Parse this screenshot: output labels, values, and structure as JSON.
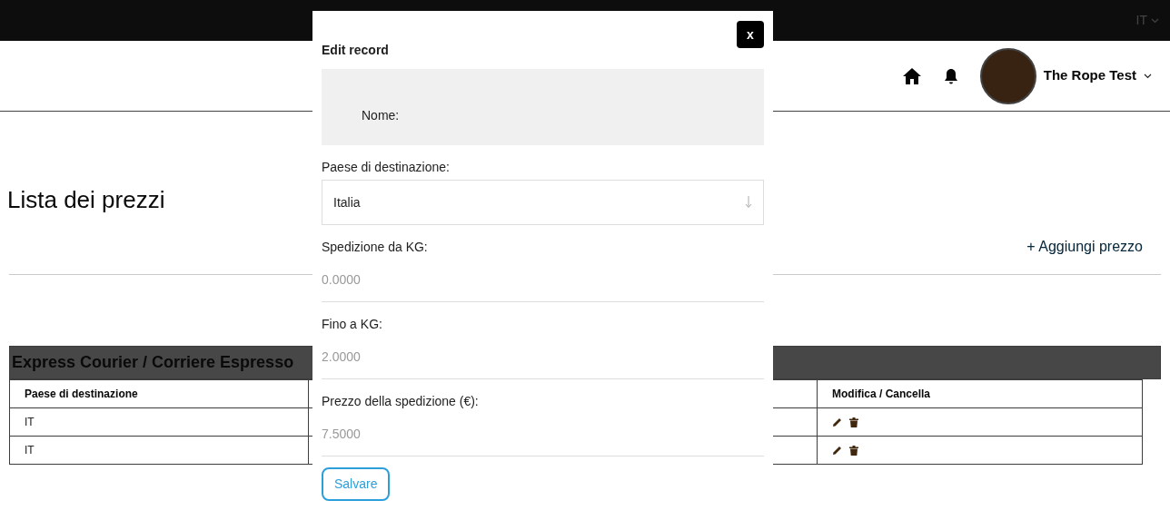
{
  "top_bar": {
    "language": "IT"
  },
  "header": {
    "user_name": "The Rope Test"
  },
  "page": {
    "title": "Lista dei prezzi",
    "add_link": "+ Aggiungi prezzo"
  },
  "section": {
    "title": "Express Courier / Corriere Espresso"
  },
  "table": {
    "columns": [
      "Paese di destinazione",
      "Modifica / Cancella"
    ],
    "rows": [
      {
        "destination": "IT"
      },
      {
        "destination": "IT"
      }
    ]
  },
  "modal": {
    "title": "Edit record",
    "close": "x",
    "name_label": "Nome:",
    "fields": [
      {
        "kind": "select",
        "label": "Paese di destinazione:",
        "value": "Italia"
      },
      {
        "kind": "number",
        "label": "Spedizione da KG:",
        "placeholder": "0.0000"
      },
      {
        "kind": "number",
        "label": "Fino a KG:",
        "placeholder": "2.0000"
      },
      {
        "kind": "number",
        "label": "Prezzo della spedizione (€):",
        "placeholder": "7.5000"
      }
    ],
    "save_button": "Salvare"
  }
}
